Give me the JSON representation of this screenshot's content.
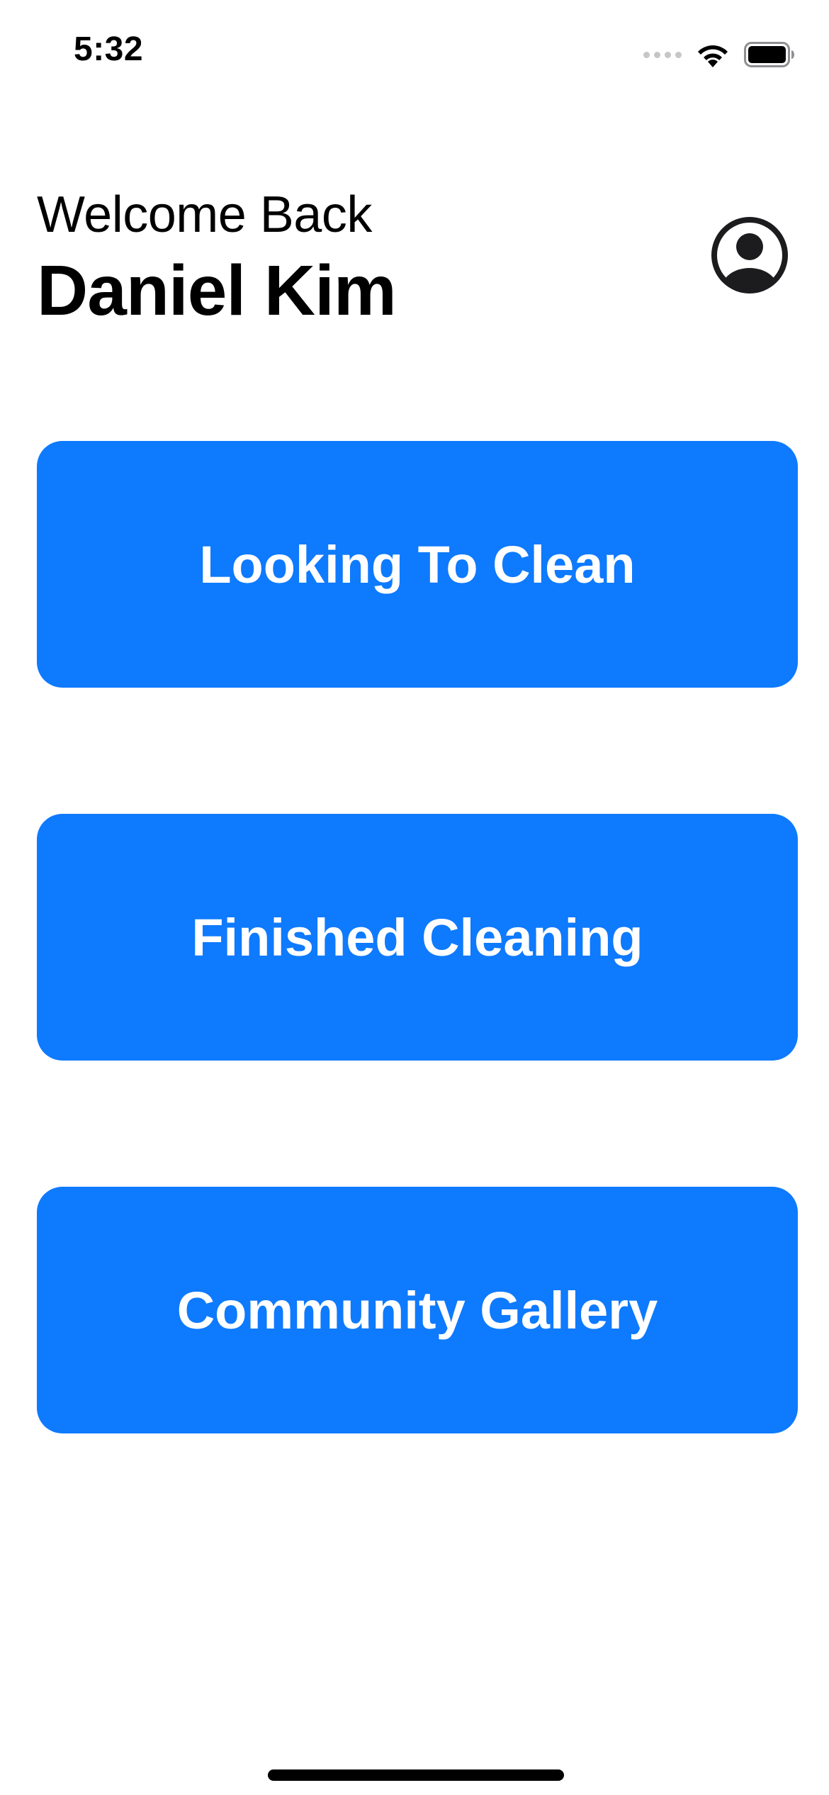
{
  "status_bar": {
    "time": "5:32",
    "icons": [
      "cellular-signal-icon",
      "wifi-icon",
      "battery-icon"
    ]
  },
  "header": {
    "greeting": "Welcome Back",
    "user_name": "Daniel Kim",
    "profile_icon": "person-circle-icon"
  },
  "actions": [
    {
      "label": "Looking To Clean"
    },
    {
      "label": "Finished Cleaning"
    },
    {
      "label": "Community Gallery"
    }
  ],
  "colors": {
    "accent": "#0e7afe",
    "button_text": "#ffffff",
    "background": "#ffffff",
    "text": "#000000"
  }
}
